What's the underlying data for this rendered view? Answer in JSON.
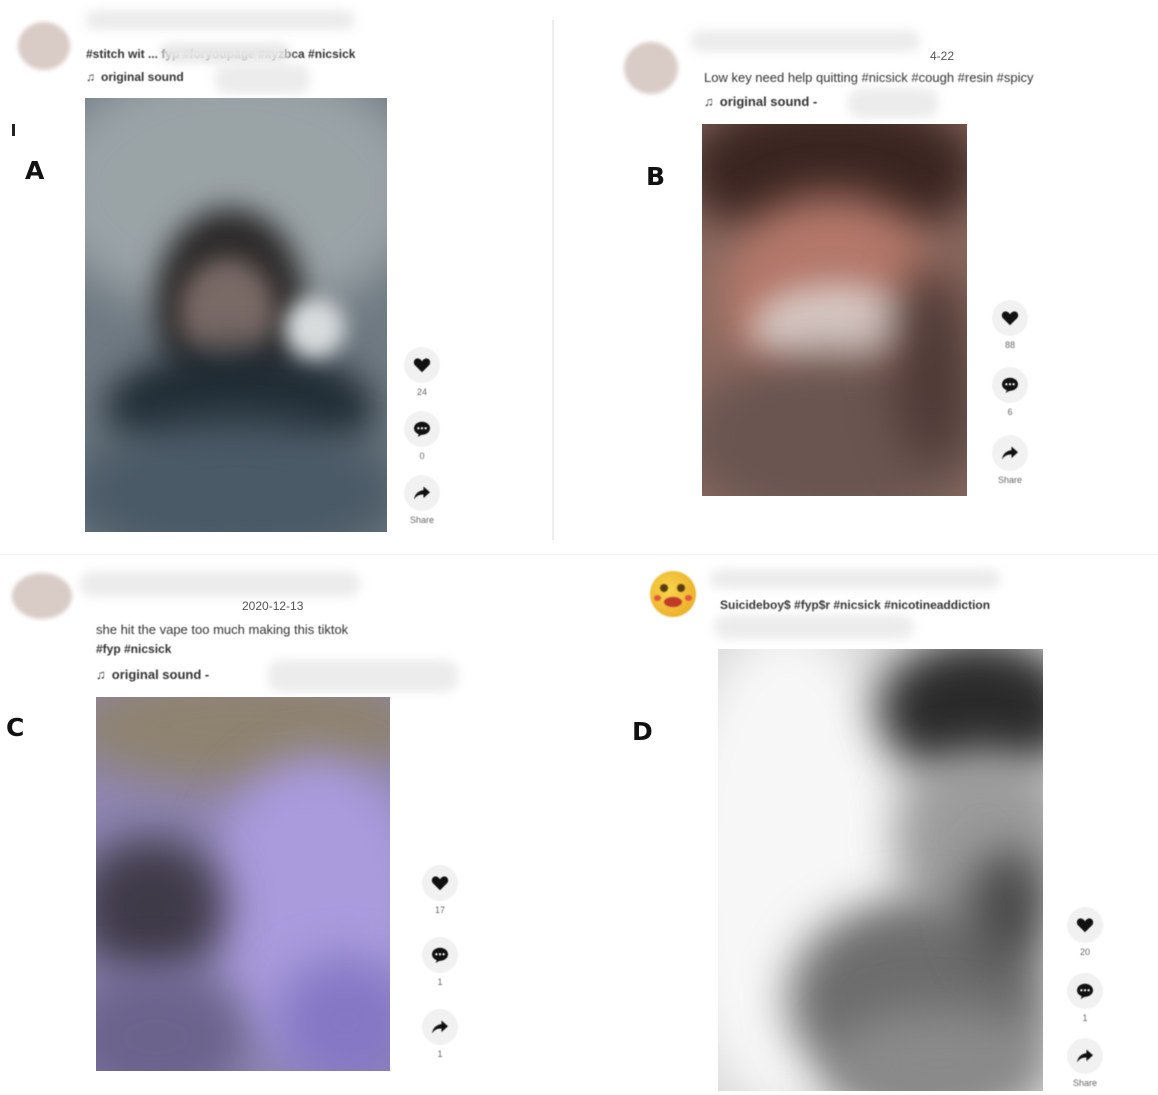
{
  "panels": {
    "a": {
      "letter": "A",
      "caption": "#stitch wit ... fyp #foryoupage #xyzbca #nicsick",
      "sound": "original sound",
      "likes": "24",
      "comments": "0",
      "share": "Share"
    },
    "b": {
      "letter": "B",
      "date": "4-22",
      "caption": "Low key need help quitting #nicsick #cough #resin #spicy",
      "sound": "original sound -",
      "likes": "88",
      "comments": "6",
      "share": "Share"
    },
    "c": {
      "letter": "C",
      "date": "2020-12-13",
      "caption_line1": "she hit the vape too much making this tiktok",
      "caption_line2": "#fyp #nicsick",
      "sound": "original sound -",
      "likes": "17",
      "comments": "1",
      "shares": "1"
    },
    "d": {
      "letter": "D",
      "caption": "Suicideboy$ #fyp$r #nicsick #nicotineaddiction",
      "likes": "20",
      "comments": "1",
      "share": "Share"
    }
  },
  "icons": {
    "note": "music-note-icon",
    "like": "heart-icon",
    "comment": "comment-icon",
    "share": "share-arrow-icon"
  }
}
